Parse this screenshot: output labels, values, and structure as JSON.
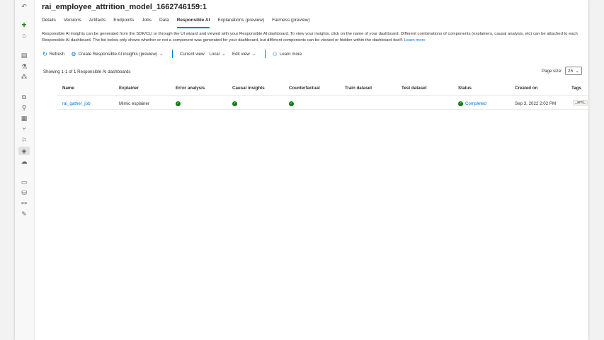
{
  "title": "rai_employee_attrition_model_1662746159:1",
  "tabs": [
    "Details",
    "Versions",
    "Artifacts",
    "Endpoints",
    "Jobs",
    "Data",
    "Responsible AI",
    "Explanations (preview)",
    "Fairness (preview)"
  ],
  "description": {
    "text": "Responsible AI insights can be generated from the SDK/CLI or through the UI wizard and viewed with your Responsible AI dashboard. To view your insights, click on the name of your dashboard. Different combinations of components (explainers, causal analysis, etc) can be attached to each Responsible AI dashboard. The list below only shows whether or not a component was generated for your dashboard, but different components can be viewed or hidden within the dashboard itself.",
    "link": "Learn more"
  },
  "toolbar": {
    "refresh": "Refresh",
    "create": "Create Responsible AI insights (preview)",
    "current_view_label": "Current view:",
    "current_view_value": "Local",
    "edit_view": "Edit view",
    "learn_more": "Learn more"
  },
  "list": {
    "showing": "Showing 1-1 of 1 Responsible AI dashboards",
    "page_size_label": "Page size:",
    "page_size_value": "25",
    "columns": [
      "Name",
      "Explainer",
      "Error analysis",
      "Causal insights",
      "Counterfactual",
      "Train dataset",
      "Test dataset",
      "Status",
      "Created on",
      "Tags"
    ],
    "rows": [
      {
        "name": "rai_gather_job",
        "explainer": "Mimic explainer",
        "error_analysis": "check-circle-icon",
        "causal_insights": "check-circle-icon",
        "counterfactual": "check-circle-icon",
        "train_dataset": "",
        "test_dataset": "",
        "status": "Completed",
        "created_on": "Sep 3, 2022 2:02 PM",
        "tags": "_aml_"
      }
    ]
  },
  "colors": {
    "accent": "#0078d4",
    "success": "#107c10"
  }
}
